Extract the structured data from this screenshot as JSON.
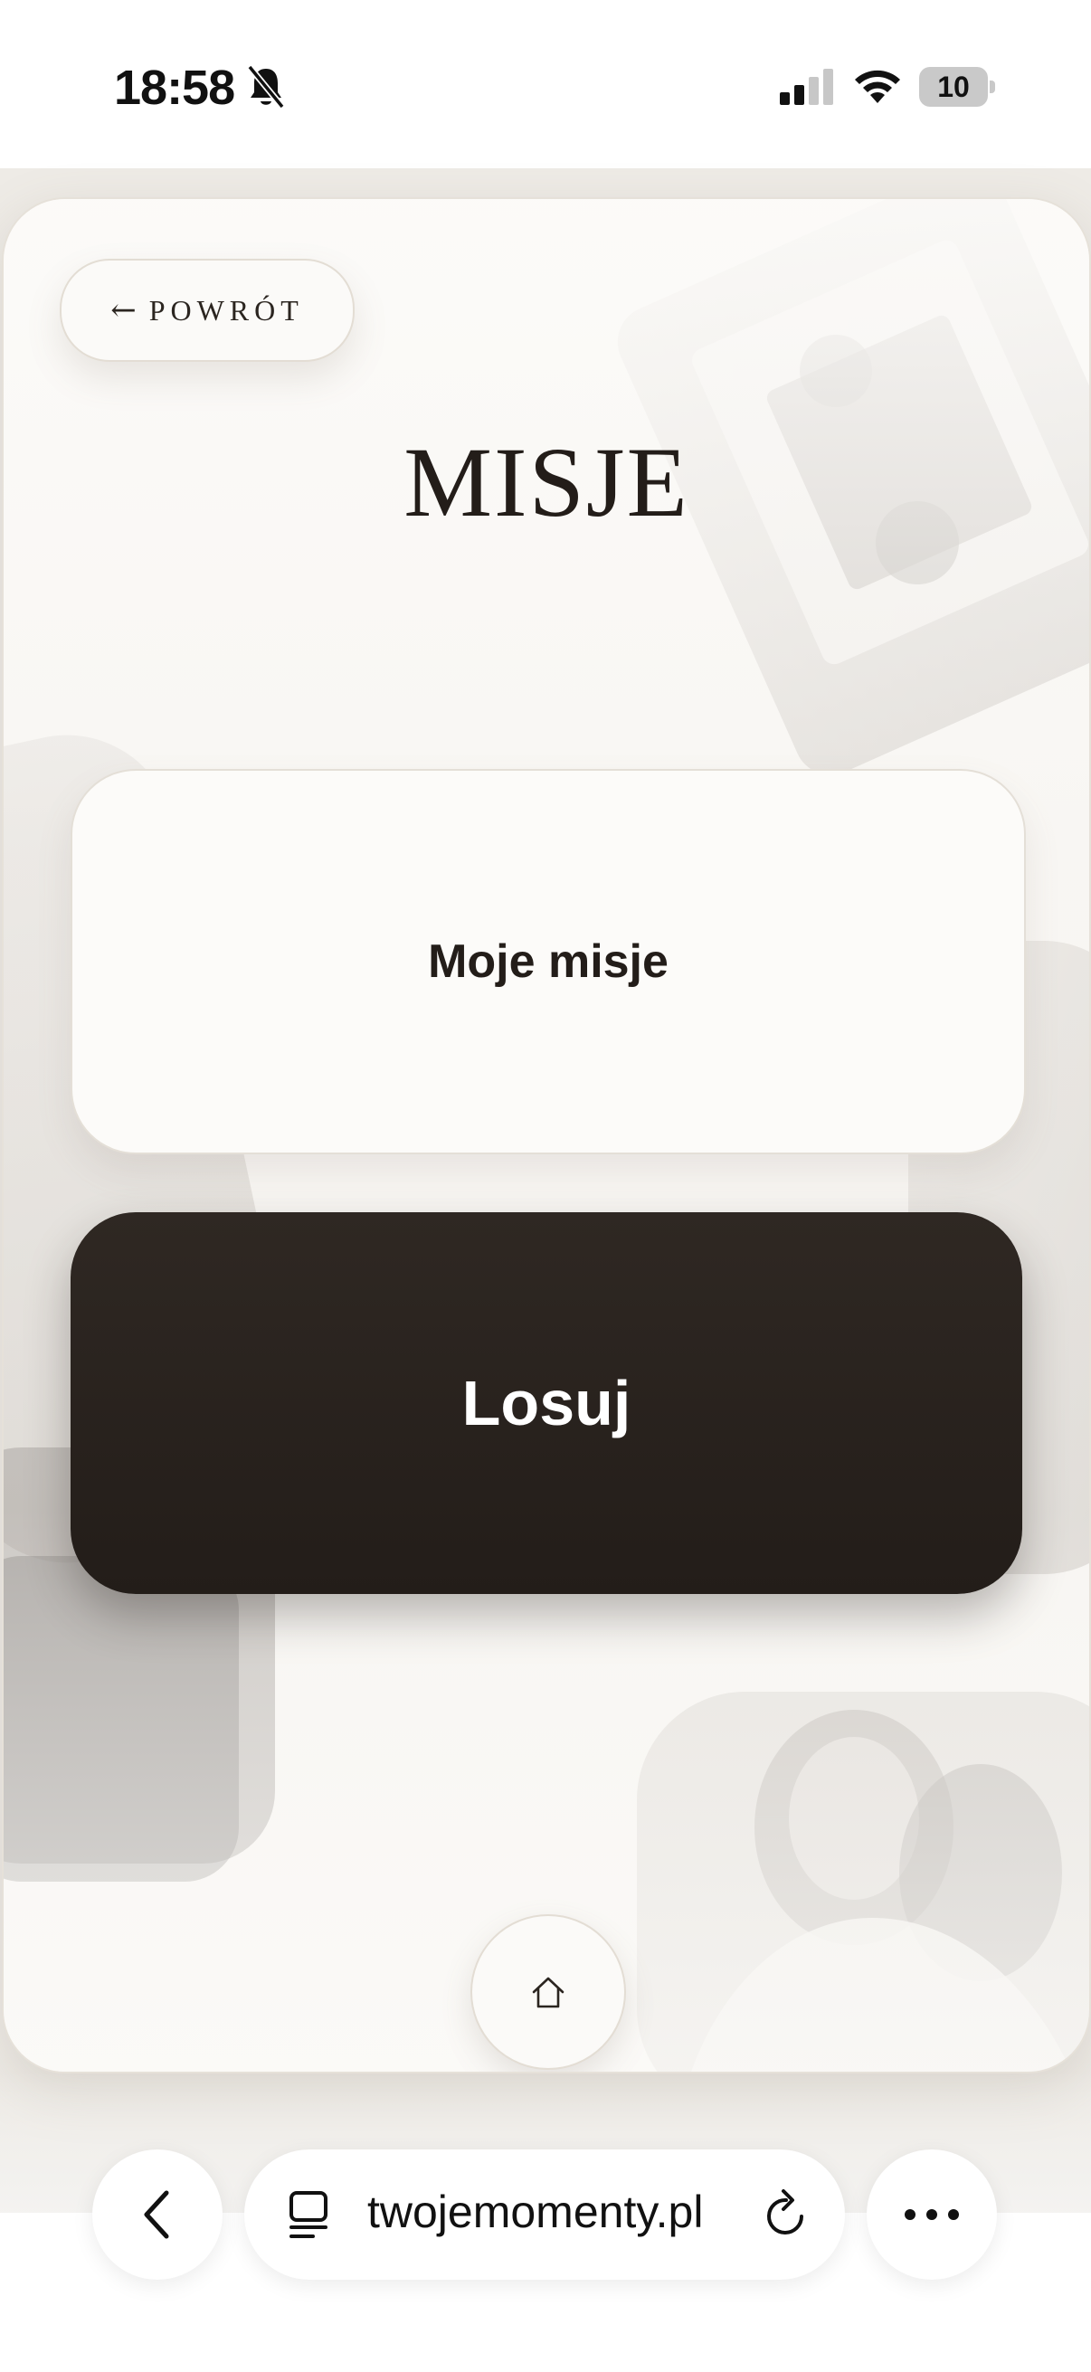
{
  "status_bar": {
    "time": "18:58",
    "battery": "10",
    "icons": [
      "bell-slash-icon",
      "cellular-signal-icon",
      "wifi-icon",
      "battery-icon"
    ]
  },
  "header": {
    "back_arrow": "←",
    "back_label": "POWRÓT",
    "title": "MISJE"
  },
  "actions": {
    "my_missions_label": "Moje misje",
    "draw_label": "Losuj"
  },
  "footer": {
    "home_icon": "house-icon"
  },
  "browser": {
    "url": "twojemomenty.pl",
    "icons": [
      "chevron-left-icon",
      "tabs-icon",
      "reload-icon",
      "more-icon"
    ]
  },
  "colors": {
    "accent_dark": "#231d19",
    "card_bg": "#f6f4f0",
    "button_light": "#fcfbf9"
  }
}
